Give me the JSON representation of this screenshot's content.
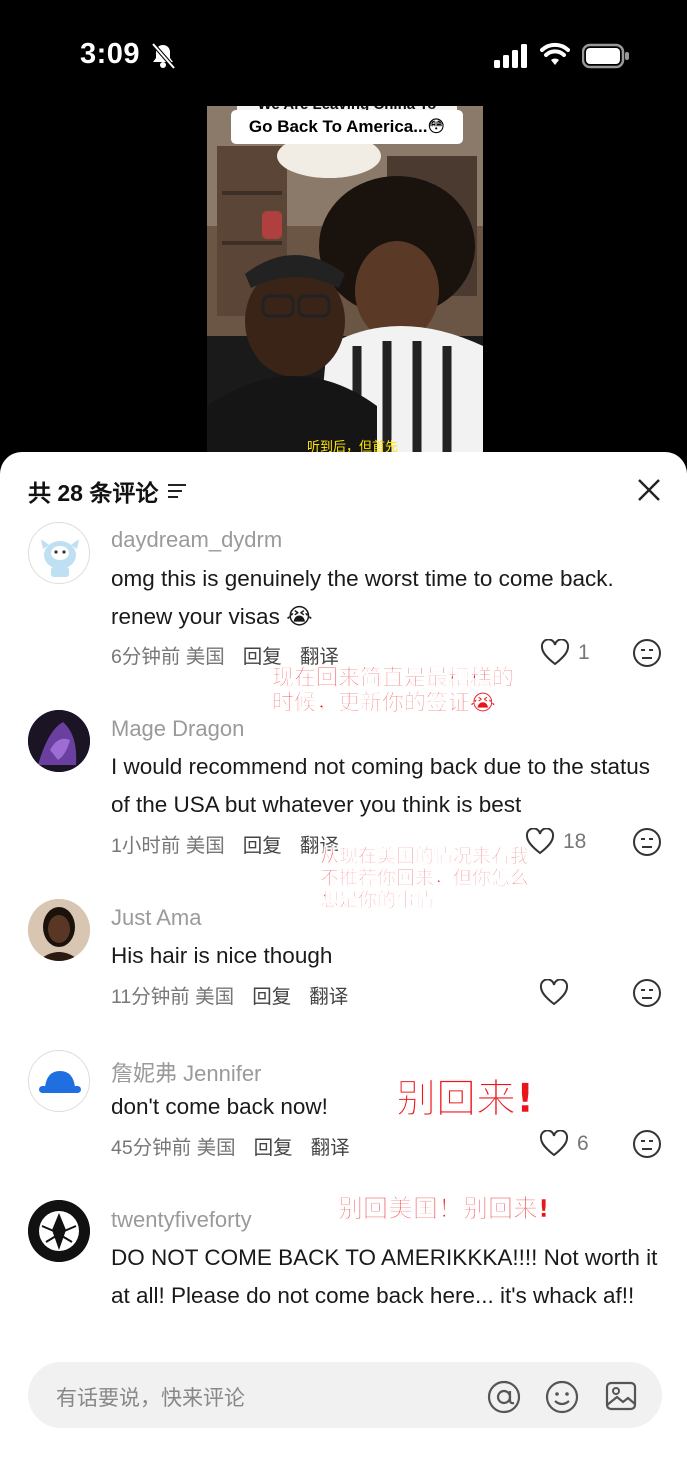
{
  "status": {
    "time": "3:09"
  },
  "video": {
    "caption_top": "We Are Leaving China To",
    "caption": "Go Back To America...😳",
    "subtitle": "听到后，但首先"
  },
  "sheet": {
    "header": "共 28 条评论",
    "input_placeholder": "有话要说，快来评论"
  },
  "comments": [
    {
      "username": "daydream_dydrm",
      "text": "omg this is genuinely the worst time to come back. renew your visas 😭",
      "time": "6分钟前",
      "location": "美国",
      "reply": "回复",
      "translate": "翻译",
      "likes": "1"
    },
    {
      "username": "Mage Dragon",
      "text": "I would recommend not coming back due to the status of the USA but whatever you think is best",
      "time": "1小时前",
      "location": "美国",
      "reply": "回复",
      "translate": "翻译",
      "likes": "18"
    },
    {
      "username": "Just Ama",
      "text": "His hair is nice though",
      "time": "11分钟前",
      "location": "美国",
      "reply": "回复",
      "translate": "翻译",
      "likes": ""
    },
    {
      "username": "詹妮弗 Jennifer",
      "text": "don't come back now!",
      "time": "45分钟前",
      "location": "美国",
      "reply": "回复",
      "translate": "翻译",
      "likes": "6"
    },
    {
      "username": "twentyfiveforty",
      "text": "DO NOT COME BACK TO AMERIKKKA!!!! Not worth it at all! Please do not come back here... it's whack af!!",
      "time": "",
      "location": "",
      "reply": "",
      "translate": "",
      "likes": ""
    }
  ],
  "annotations": {
    "note1_line1": "现在回来简直是最糟糕的",
    "note1_line2": "时候，更新你的签证😭",
    "note2_line1": "从现在美国的情况来看我",
    "note2_line2": "不推荐你回来，但你怎么",
    "note2_line3": "想是你的事情",
    "note3": "别回来!",
    "note4": "别回美国！别回来!"
  },
  "colors": {
    "annotation_red": "#e8151b",
    "sheet_bg": "#ffffff",
    "meta_gray": "#777777"
  },
  "icons": [
    "bell-slash-icon",
    "signal-icon",
    "wifi-icon",
    "battery-icon",
    "filter-icon",
    "close-icon",
    "heart-icon",
    "dislike-face-icon",
    "at-icon",
    "emoji-icon",
    "image-icon"
  ]
}
